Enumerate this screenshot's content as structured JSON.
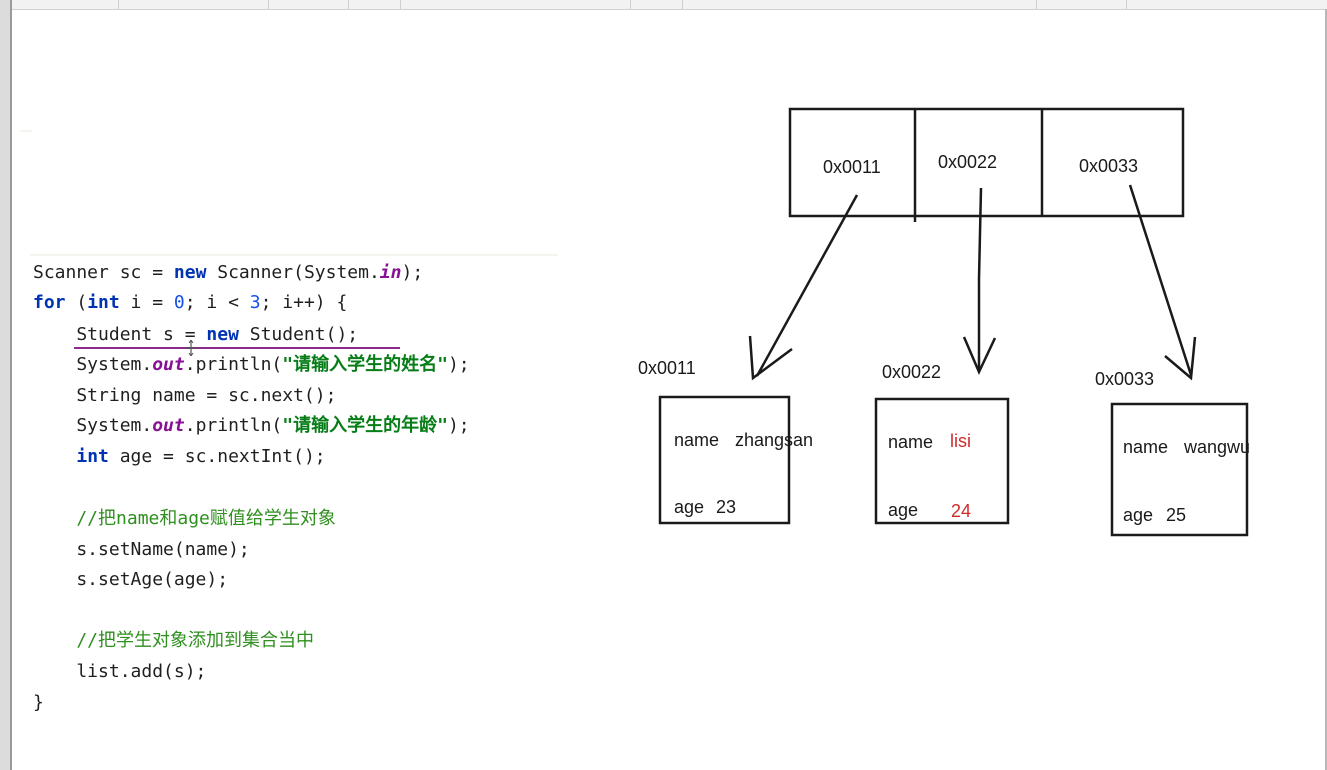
{
  "code": {
    "lines": [
      [
        "Scanner sc = ",
        "new",
        " Scanner(System.",
        "in",
        ");"
      ],
      [
        "for",
        " (",
        "int",
        " i = ",
        "0",
        "; i < ",
        "3",
        "; i++) {"
      ],
      [
        "    Student s = ",
        "new",
        " Student();"
      ],
      [
        "    System.",
        "out",
        ".println(",
        "\"请输入学生的姓名\"",
        ");"
      ],
      [
        "    String name = sc.next();"
      ],
      [
        "    System.",
        "out",
        ".println(",
        "\"请输入学生的年龄\"",
        ");"
      ],
      [
        "    ",
        "int",
        " age = sc.nextInt();"
      ],
      [
        "    //把name和age赋值给学生对象"
      ],
      [
        "    s.setName(name);"
      ],
      [
        "    s.setAge(age);"
      ],
      [
        "    //把学生对象添加到集合当中"
      ],
      [
        "    list.add(s);"
      ],
      [
        "}"
      ]
    ]
  },
  "diagram": {
    "array_cells": [
      "0x0011",
      "0x0022",
      "0x0033"
    ],
    "objects": [
      {
        "address": "0x0011",
        "name_label": "name",
        "name_value": "zhangsan",
        "age_label": "age",
        "age_value": "23"
      },
      {
        "address": "0x0022",
        "name_label": "name",
        "name_value": "lisi",
        "age_label": "age",
        "age_value": "24"
      },
      {
        "address": "0x0033",
        "name_label": "name",
        "name_value": "wangwu",
        "age_label": "age",
        "age_value": "25"
      }
    ],
    "colors": {
      "ink": "#1a1a1a",
      "highlight": "#d12a2a"
    }
  },
  "colors": {
    "keyword": "#0033b3",
    "static_field": "#871094",
    "number": "#1750eb",
    "string": "#067d17",
    "comment": "#2f8f1f",
    "underline": "#8a2a8a"
  }
}
